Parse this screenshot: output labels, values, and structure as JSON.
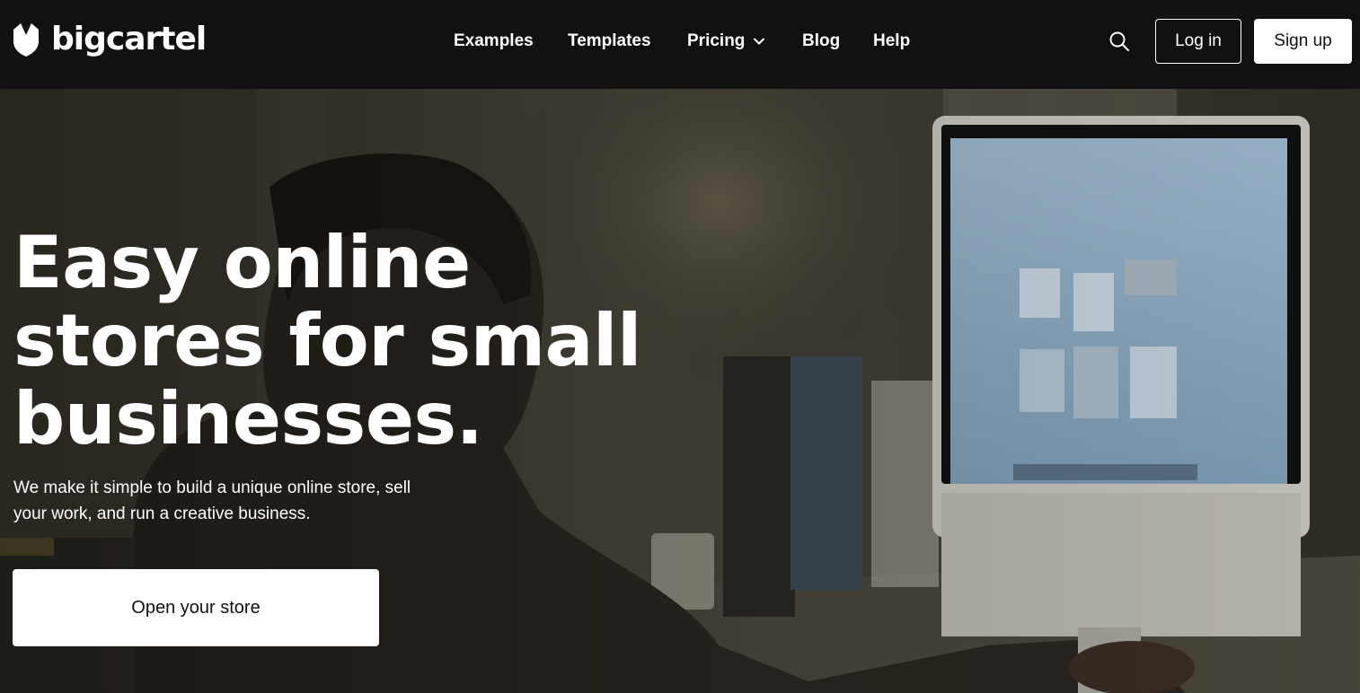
{
  "brand": {
    "name": "bigcartel",
    "logo_icon": "bigcartel-shield-logo-icon"
  },
  "nav": {
    "items": [
      {
        "label": "Examples"
      },
      {
        "label": "Templates"
      },
      {
        "label": "Pricing",
        "has_dropdown": true,
        "icon": "chevron-down-icon"
      },
      {
        "label": "Blog"
      },
      {
        "label": "Help"
      }
    ]
  },
  "header_actions": {
    "search_icon": "search-icon",
    "login_label": "Log in",
    "signup_label": "Sign up"
  },
  "hero": {
    "title_lines": [
      "Easy online",
      "stores for small",
      "businesses."
    ],
    "subtitle_lines": [
      "We make it simple to build a unique online store, sell",
      "your work, and run a creative business."
    ],
    "cta_label": "Open your store",
    "background": "photo of a woman at a desk using an iMac"
  },
  "colors": {
    "header_bg": "#111111",
    "text": "#ffffff",
    "button_bg": "#ffffff",
    "button_text": "#111111"
  }
}
